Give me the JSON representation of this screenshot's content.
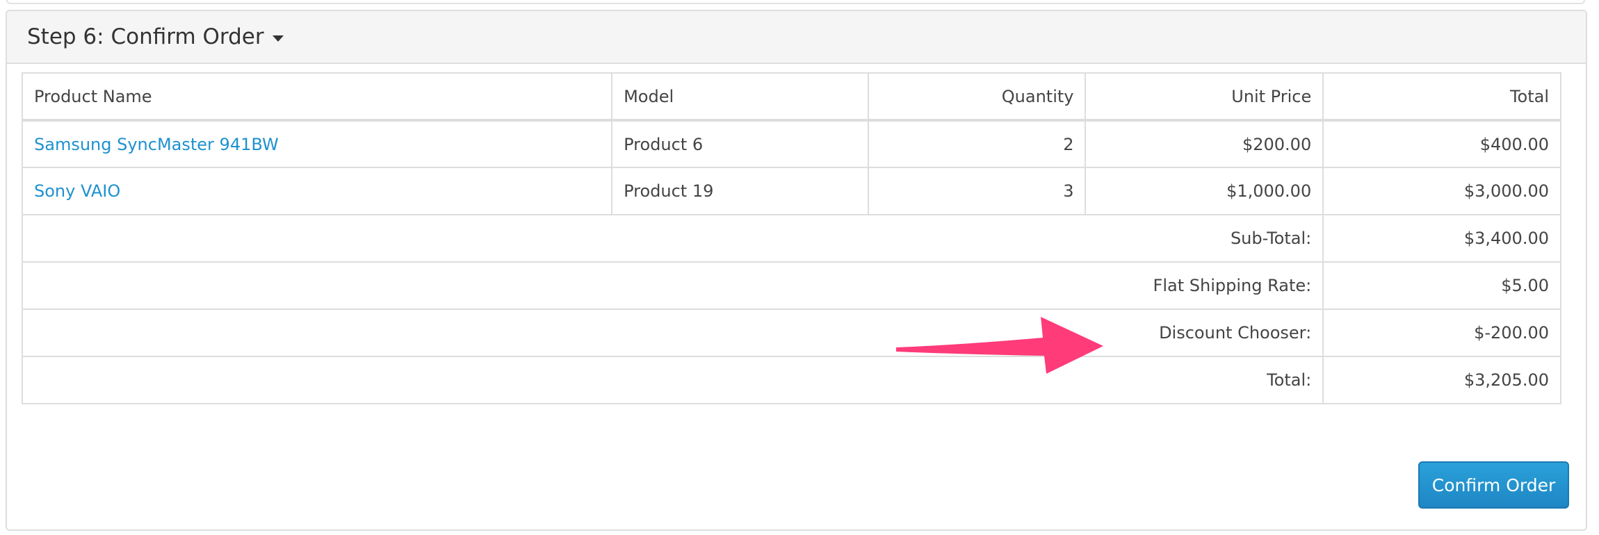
{
  "panel": {
    "title": "Step 6: Confirm Order"
  },
  "table": {
    "headers": {
      "product_name": "Product Name",
      "model": "Model",
      "quantity": "Quantity",
      "unit_price": "Unit Price",
      "total": "Total"
    },
    "rows": [
      {
        "name": "Samsung SyncMaster 941BW",
        "model": "Product 6",
        "quantity": "2",
        "unit_price": "$200.00",
        "total": "$400.00"
      },
      {
        "name": "Sony VAIO",
        "model": "Product 19",
        "quantity": "3",
        "unit_price": "$1,000.00",
        "total": "$3,000.00"
      }
    ],
    "totals": [
      {
        "label": "Sub-Total:",
        "value": "$3,400.00"
      },
      {
        "label": "Flat Shipping Rate:",
        "value": "$5.00"
      },
      {
        "label": "Discount Chooser:",
        "value": "$-200.00"
      },
      {
        "label": "Total:",
        "value": "$3,205.00"
      }
    ]
  },
  "annotation": {
    "arrow_color": "#ff3b7a"
  },
  "button": {
    "confirm_label": "Confirm Order"
  },
  "colors": {
    "link": "#1e91cf",
    "button": "#1e91cf"
  }
}
